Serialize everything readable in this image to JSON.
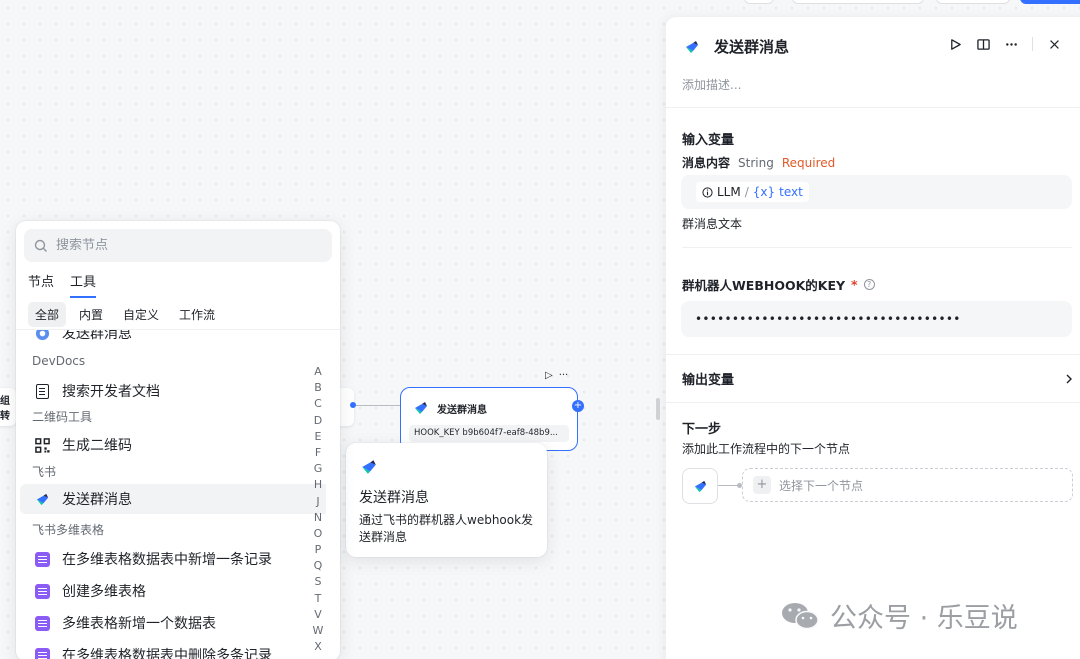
{
  "picker": {
    "search_placeholder": "搜索节点",
    "main_tabs": [
      "节点",
      "工具"
    ],
    "sub_tabs": [
      "全部",
      "内置",
      "自定义",
      "工作流"
    ],
    "top_cut_item": "发送群消息",
    "groups": {
      "devdocs": "DevDocs",
      "qrcode": "二维码工具",
      "feishu": "飞书",
      "bitable": "飞书多维表格"
    },
    "items": {
      "search_docs": "搜索开发者文档",
      "gen_qr": "生成二维码",
      "send_group_msg": "发送群消息",
      "add_record": "在多维表格数据表中新增一条记录",
      "create_bitable": "创建多维表格",
      "add_table": "多维表格新增一个数据表",
      "delete_records": "在多维表格数据表中删除多条记录"
    },
    "alphabet": [
      "A",
      "B",
      "C",
      "D",
      "E",
      "F",
      "G",
      "H",
      "J",
      "N",
      "O",
      "P",
      "Q",
      "S",
      "T",
      "V",
      "W",
      "X"
    ]
  },
  "canvas": {
    "left_node_text": "组转",
    "node_tools": {
      "run": "▷",
      "more": "···"
    },
    "flow_node": {
      "title": "发送群消息",
      "hook_value": "HOOK_KEY b9b604f7-eaf8-48b9..."
    },
    "tooltip": {
      "title": "发送群消息",
      "desc": "通过飞书的群机器人webhook发送群消息"
    }
  },
  "panel": {
    "title": "发送群消息",
    "description_placeholder": "添加描述...",
    "input_vars_label": "输入变量",
    "field": {
      "name": "消息内容",
      "type": "String",
      "required": "Required",
      "source": "LLM",
      "separator": "/",
      "var_prefix": "{x}",
      "var_name": "text",
      "hint": "群消息文本"
    },
    "key_field": {
      "label": "群机器人WEBHOOK的KEY",
      "star": "*",
      "value": "••••••••••••••••••••••••••••••••••••"
    },
    "output_vars_label": "输出变量",
    "next_step": {
      "title": "下一步",
      "desc": "添加此工作流程中的下一个节点",
      "add_label": "选择下一个节点"
    }
  },
  "watermark": {
    "text": "公众号 · 乐豆说"
  },
  "colors": {
    "accent": "#3370ff",
    "required": "#e05a28",
    "bitable": "#8a5cf5"
  }
}
